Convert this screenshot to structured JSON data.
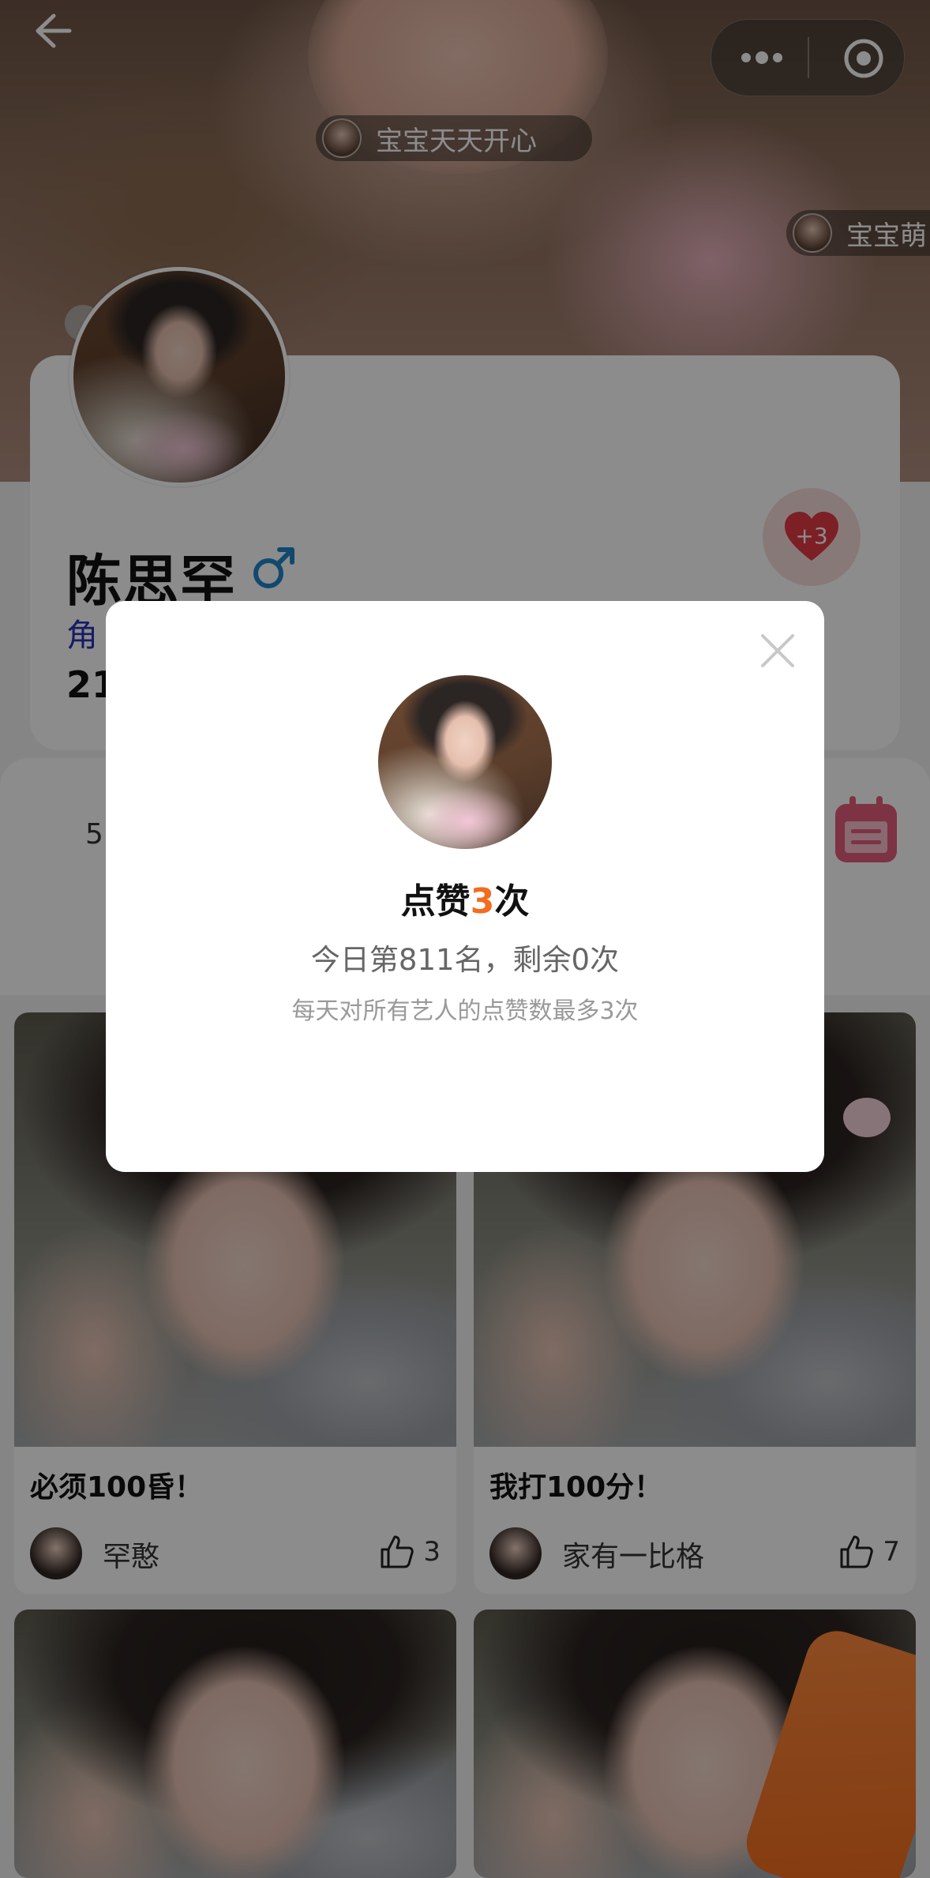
{
  "header": {
    "danmu": [
      {
        "text": "宝宝天天开心"
      },
      {
        "text": "宝宝萌"
      }
    ]
  },
  "profile": {
    "name": "陈思罕",
    "role_partial": "角",
    "count_partial": "21",
    "like_plus": "+3"
  },
  "stats": {
    "partial_value": "5"
  },
  "feed": [
    {
      "title": "必须100昏！",
      "user": "罕憨",
      "likes": "3"
    },
    {
      "title": "我打100分！",
      "user": "家有一比格",
      "likes": "7"
    }
  ],
  "modal": {
    "title_prefix": "点赞",
    "title_count": "3",
    "title_suffix": "次",
    "subtitle": "今日第811名，剩余0次",
    "note": "每天对所有艺人的点赞数最多3次"
  },
  "colors": {
    "accent": "#f36c1f",
    "role_text": "#2a32b8",
    "heart": "#e23b45",
    "gender": "#1f86c9",
    "calendar": "#e35d7a"
  },
  "icons": [
    "back-arrow-icon",
    "more-dots-icon",
    "target-icon",
    "male-icon",
    "heart-icon",
    "calendar-icon",
    "thumbs-up-icon",
    "close-icon"
  ]
}
